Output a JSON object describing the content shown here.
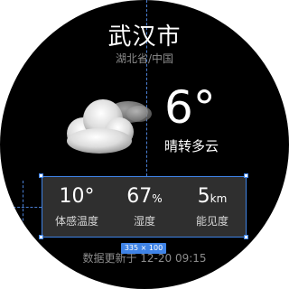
{
  "location": {
    "city": "武汉市",
    "region": "湖北省/中国"
  },
  "current": {
    "temperature": "6°",
    "condition": "晴转多云",
    "icon": "cloud-icon"
  },
  "stats": [
    {
      "value": "10°",
      "unit": "",
      "label": "体感温度"
    },
    {
      "value": "67",
      "unit": "%",
      "label": "湿度"
    },
    {
      "value": "5",
      "unit": "km",
      "label": "能见度"
    }
  ],
  "selection": {
    "size_label": "335 × 100"
  },
  "footer": {
    "updated": "数据更新于 12-20 09:15"
  },
  "colors": {
    "background": "#000000",
    "panel": "#2f2f2f",
    "selection": "#3f83e6",
    "muted_text": "#8c8c8c"
  }
}
